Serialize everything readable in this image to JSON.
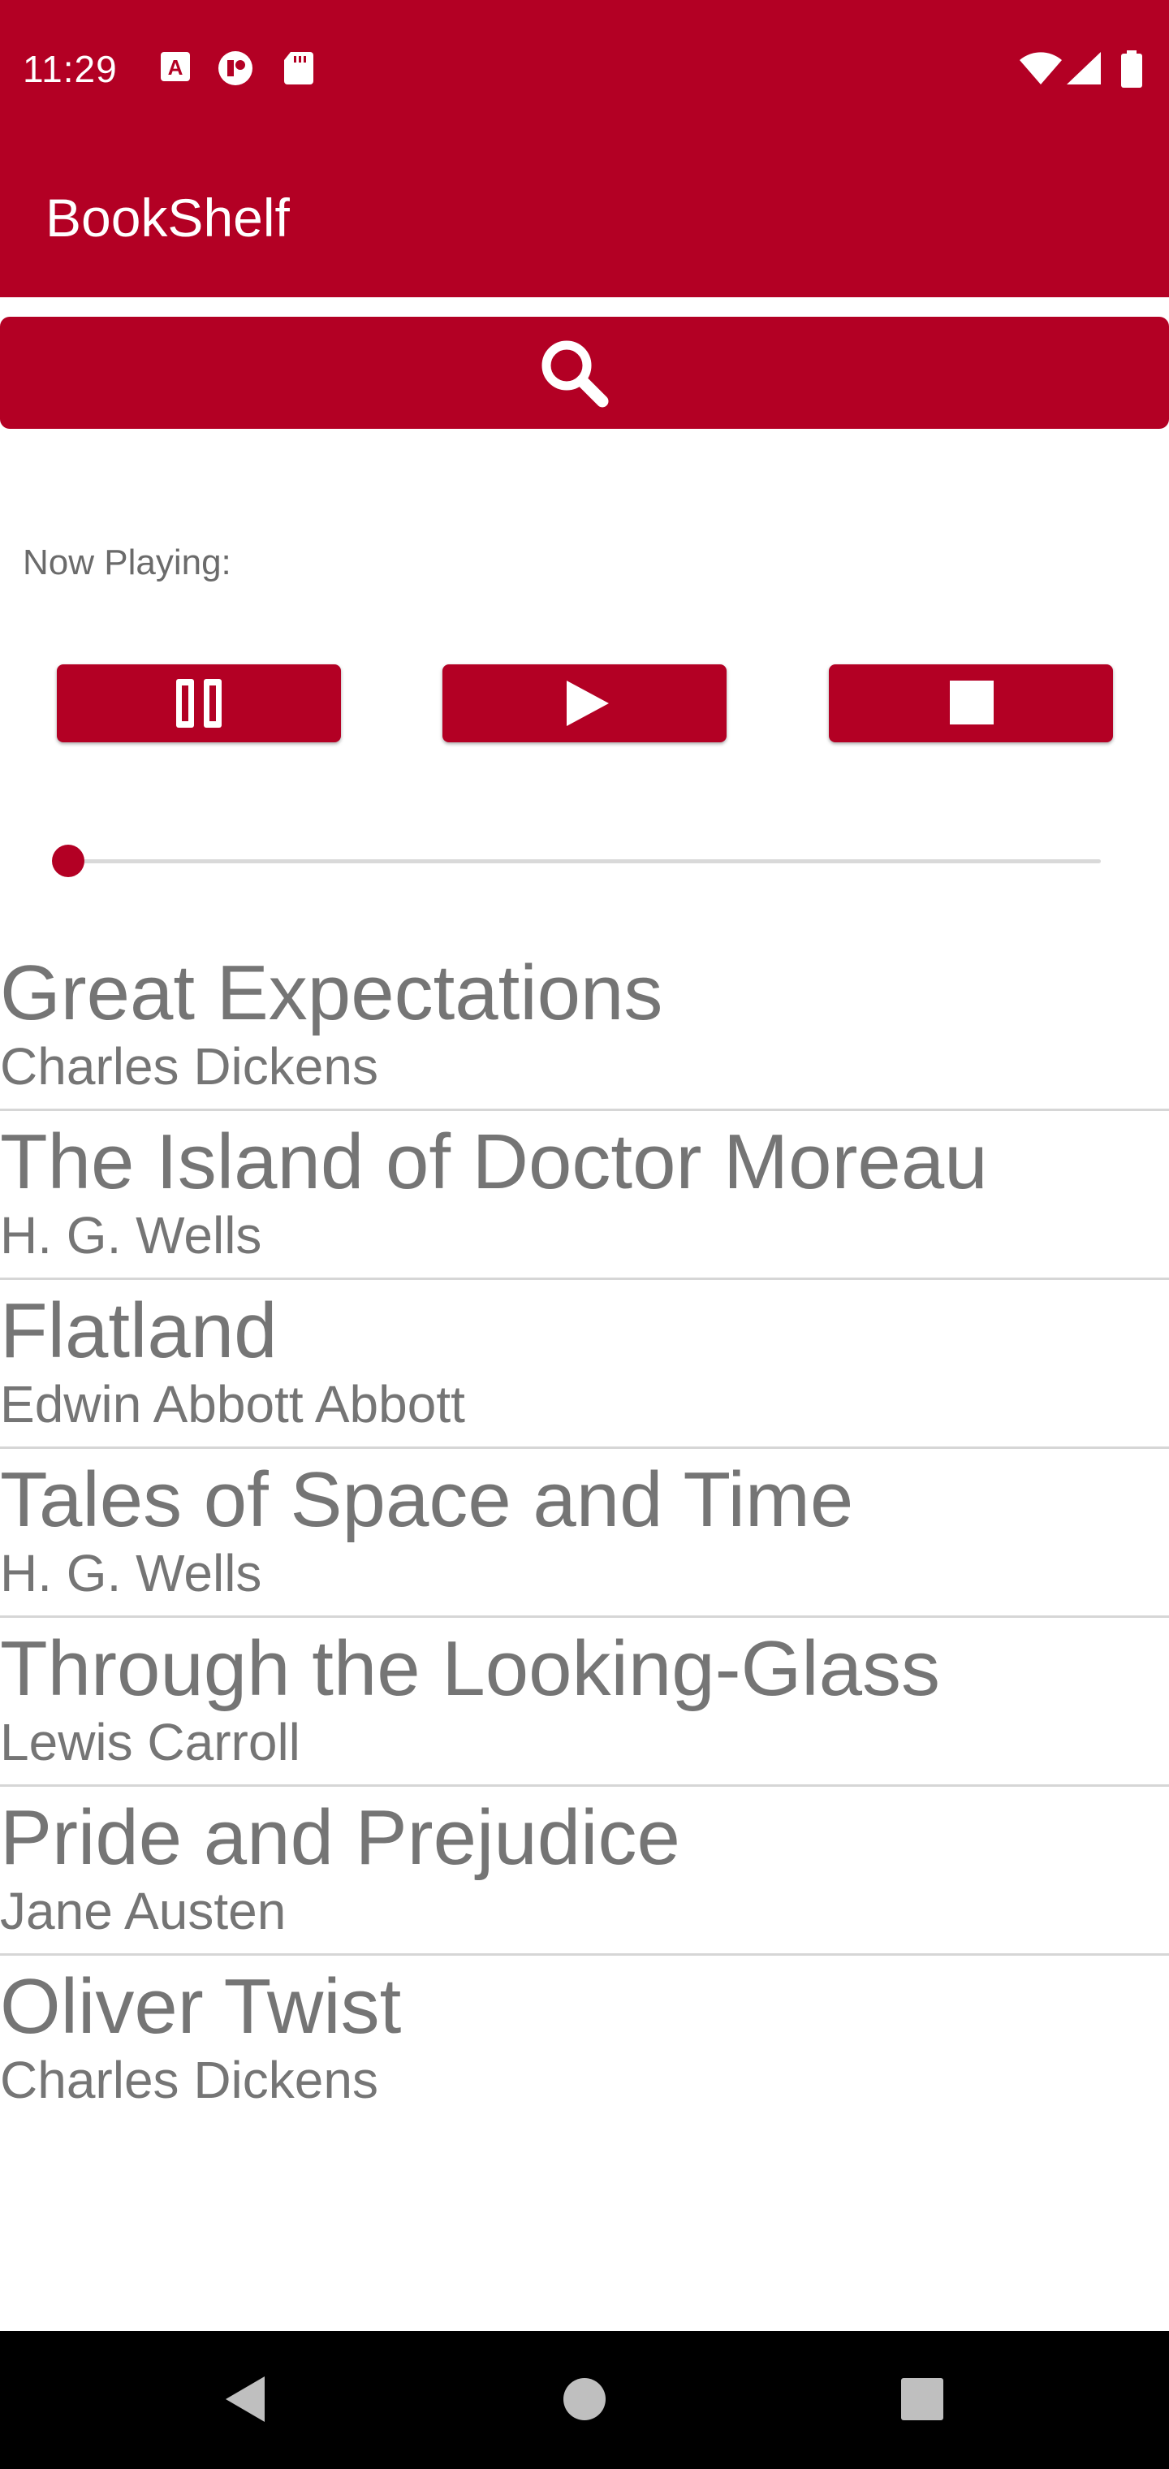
{
  "status_bar": {
    "time": "11:29",
    "left_icons": [
      "text-a-icon",
      "notification-icon",
      "sd-card-icon"
    ],
    "right_icons": [
      "wifi-icon",
      "signal-icon",
      "battery-icon"
    ]
  },
  "app_bar": {
    "title": "BookShelf"
  },
  "search": {
    "icon": "search-icon"
  },
  "player": {
    "now_playing_label": "Now Playing:",
    "controls": [
      "pause-icon",
      "play-icon",
      "stop-icon"
    ],
    "progress": 0
  },
  "books": [
    {
      "title": "Great Expectations",
      "author": "Charles Dickens"
    },
    {
      "title": "The Island of Doctor Moreau",
      "author": "H. G. Wells"
    },
    {
      "title": "Flatland",
      "author": "Edwin Abbott Abbott"
    },
    {
      "title": "Tales of Space and Time",
      "author": "H. G. Wells"
    },
    {
      "title": "Through the Looking-Glass",
      "author": "Lewis Carroll"
    },
    {
      "title": "Pride and Prejudice",
      "author": "Jane Austen"
    },
    {
      "title": "Oliver Twist",
      "author": "Charles Dickens"
    }
  ],
  "nav_bar": {
    "buttons": [
      "back-icon",
      "home-icon",
      "recents-icon"
    ]
  },
  "colors": {
    "accent": "#b30024",
    "text_secondary": "#757575",
    "divider": "#d6d6d6"
  }
}
